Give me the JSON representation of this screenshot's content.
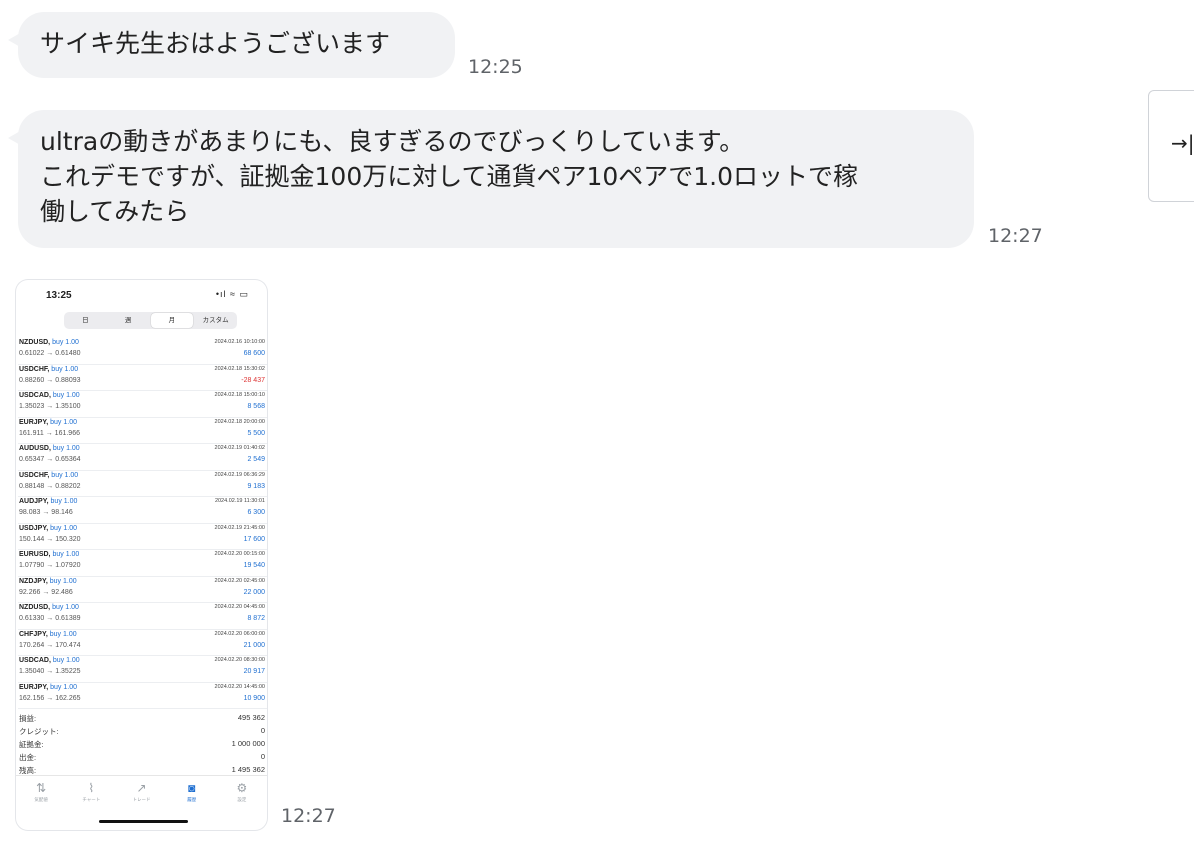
{
  "messages": [
    {
      "text": "サイキ先生おはようございます",
      "time": "12:25"
    },
    {
      "text": "ultraの動きがあまりにも、良すぎるのでびっくりしています。\nこれデモですが、証拠金100万に対して通貨ペア10ペアで1.0ロットで稼\n働してみたら",
      "time": "12:27"
    }
  ],
  "image_time": "12:27",
  "side_tab_icon": "→|",
  "phone": {
    "status_time": "13:25",
    "status_icons": "•ıl ≈ ▭",
    "segments": [
      "日",
      "週",
      "月",
      "カスタム"
    ],
    "trades": [
      {
        "pair": "NZDUSD,",
        "side": "buy 1.00",
        "prices": "0.61022 → 0.61480",
        "date": "2024.02.16 10:10:00",
        "pl": "68 600",
        "neg": false
      },
      {
        "pair": "USDCHF,",
        "side": "buy 1.00",
        "prices": "0.88260 → 0.88093",
        "date": "2024.02.18 15:30:02",
        "pl": "-28 437",
        "neg": true
      },
      {
        "pair": "USDCAD,",
        "side": "buy 1.00",
        "prices": "1.35023 → 1.35100",
        "date": "2024.02.18 15:00:10",
        "pl": "8 568",
        "neg": false
      },
      {
        "pair": "EURJPY,",
        "side": "buy 1.00",
        "prices": "161.911 → 161.966",
        "date": "2024.02.18 20:00:00",
        "pl": "5 500",
        "neg": false
      },
      {
        "pair": "AUDUSD,",
        "side": "buy 1.00",
        "prices": "0.65347 → 0.65364",
        "date": "2024.02.19 01:40:02",
        "pl": "2 549",
        "neg": false
      },
      {
        "pair": "USDCHF,",
        "side": "buy 1.00",
        "prices": "0.88148 → 0.88202",
        "date": "2024.02.19 06:36:29",
        "pl": "9 183",
        "neg": false
      },
      {
        "pair": "AUDJPY,",
        "side": "buy 1.00",
        "prices": "98.083 → 98.146",
        "date": "2024.02.19 11:30:01",
        "pl": "6 300",
        "neg": false
      },
      {
        "pair": "USDJPY,",
        "side": "buy 1.00",
        "prices": "150.144 → 150.320",
        "date": "2024.02.19 21:45:00",
        "pl": "17 600",
        "neg": false
      },
      {
        "pair": "EURUSD,",
        "side": "buy 1.00",
        "prices": "1.07790 → 1.07920",
        "date": "2024.02.20 00:15:00",
        "pl": "19 540",
        "neg": false
      },
      {
        "pair": "NZDJPY,",
        "side": "buy 1.00",
        "prices": "92.266 → 92.486",
        "date": "2024.02.20 02:45:00",
        "pl": "22 000",
        "neg": false
      },
      {
        "pair": "NZDUSD,",
        "side": "buy 1.00",
        "prices": "0.61330 → 0.61389",
        "date": "2024.02.20 04:45:00",
        "pl": "8 872",
        "neg": false
      },
      {
        "pair": "CHFJPY,",
        "side": "buy 1.00",
        "prices": "170.264 → 170.474",
        "date": "2024.02.20 06:00:00",
        "pl": "21 000",
        "neg": false
      },
      {
        "pair": "USDCAD,",
        "side": "buy 1.00",
        "prices": "1.35040 → 1.35225",
        "date": "2024.02.20 08:30:00",
        "pl": "20 917",
        "neg": false
      },
      {
        "pair": "EURJPY,",
        "side": "buy 1.00",
        "prices": "162.156 → 162.265",
        "date": "2024.02.20 14:45:00",
        "pl": "10 900",
        "neg": false
      }
    ],
    "summary": [
      {
        "k": "損益:",
        "v": "495 362"
      },
      {
        "k": "クレジット:",
        "v": "0"
      },
      {
        "k": "証拠金:",
        "v": "1 000 000"
      },
      {
        "k": "出金:",
        "v": "0"
      },
      {
        "k": "残高:",
        "v": "1 495 362"
      }
    ],
    "tabs": [
      {
        "label": "気配値",
        "icon": "⇅",
        "on": false
      },
      {
        "label": "チャート",
        "icon": "⌇",
        "on": false
      },
      {
        "label": "トレード",
        "icon": "↗",
        "on": false
      },
      {
        "label": "履歴",
        "icon": "◙",
        "on": true
      },
      {
        "label": "設定",
        "icon": "⚙",
        "on": false
      }
    ]
  }
}
